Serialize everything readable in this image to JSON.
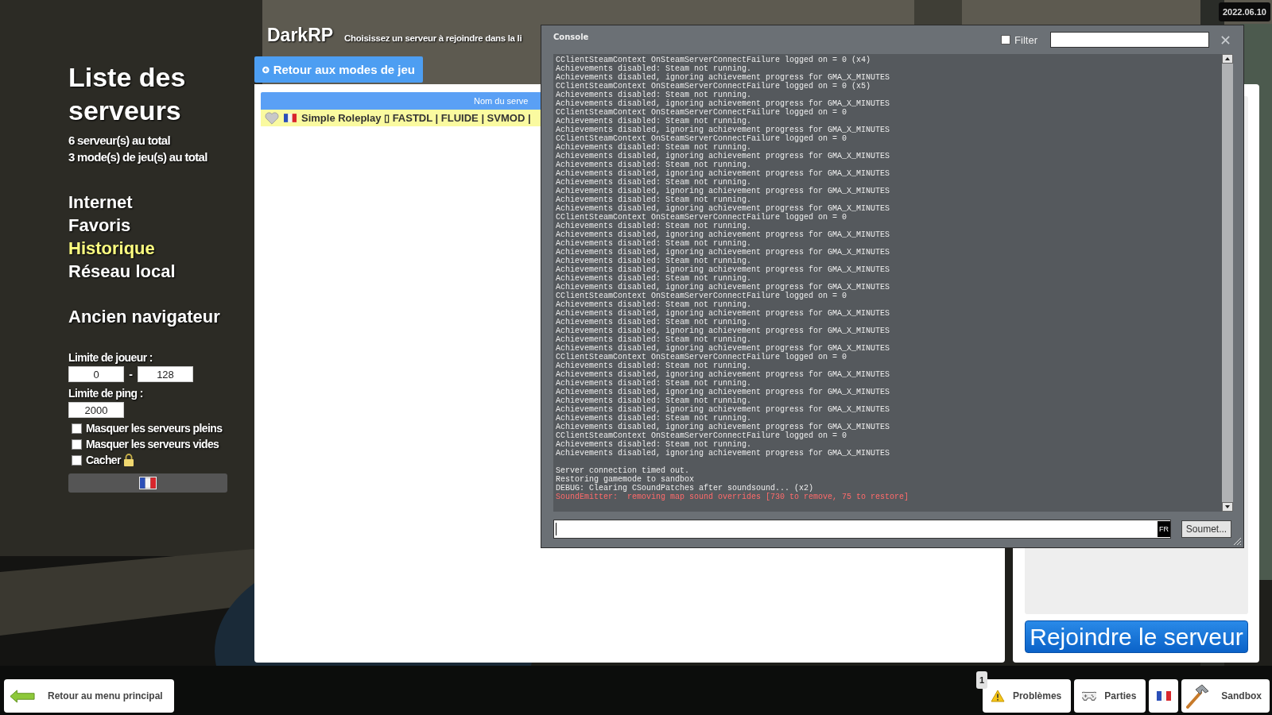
{
  "date": "2022.06.10",
  "sidebar": {
    "title": "Liste des serveurs",
    "stats": [
      "6 serveur(s) au total",
      "3 mode(s) de jeu(s) au total"
    ],
    "nav": [
      {
        "label": "Internet",
        "selected": false
      },
      {
        "label": "Favoris",
        "selected": false
      },
      {
        "label": "Historique",
        "selected": true
      },
      {
        "label": "Réseau local",
        "selected": false
      }
    ],
    "legacy_link": "Ancien navigateur",
    "player_limit": {
      "label": "Limite de joueur :",
      "min": "0",
      "separator": "-",
      "max": "128"
    },
    "ping_limit": {
      "label": "Limite de ping :",
      "value": "2000"
    },
    "options": [
      {
        "label": "Masquer les serveurs pleins",
        "checked": false,
        "locked": false
      },
      {
        "label": "Masquer les serveurs vides",
        "checked": false,
        "locked": false
      },
      {
        "label": "Cacher",
        "checked": false,
        "locked": true
      }
    ]
  },
  "header": {
    "gamemode": "DarkRP",
    "subtitle": "Choisissez un serveur à rejoindre dans la li"
  },
  "back_button": "Retour aux modes de jeu",
  "server_list": {
    "column_header": "Nom du serve",
    "rows": [
      {
        "name": "Simple Roleplay ▯ FASTDL | FLUIDE | SVMOD |",
        "selected": true
      }
    ]
  },
  "join_button": "Rejoindre le serveur",
  "console": {
    "title": "Console",
    "filter": {
      "label": "Filter",
      "checked": false
    },
    "lines": [
      {
        "kind": "log",
        "text": "CClientSteamContext OnSteamServerConnectFailure logged on = 0 (x4)"
      },
      {
        "kind": "log",
        "text": "Achievements disabled: Steam not running."
      },
      {
        "kind": "log",
        "text": "Achievements disabled, ignoring achievement progress for GMA_X_MINUTES"
      },
      {
        "kind": "log",
        "text": "CClientSteamContext OnSteamServerConnectFailure logged on = 0 (x5)"
      },
      {
        "kind": "log",
        "text": "Achievements disabled: Steam not running."
      },
      {
        "kind": "log",
        "text": "Achievements disabled, ignoring achievement progress for GMA_X_MINUTES"
      },
      {
        "kind": "log",
        "text": "CClientSteamContext OnSteamServerConnectFailure logged on = 0"
      },
      {
        "kind": "log",
        "text": "Achievements disabled: Steam not running."
      },
      {
        "kind": "log",
        "text": "Achievements disabled, ignoring achievement progress for GMA_X_MINUTES"
      },
      {
        "kind": "log",
        "text": "CClientSteamContext OnSteamServerConnectFailure logged on = 0"
      },
      {
        "kind": "log",
        "text": "Achievements disabled: Steam not running."
      },
      {
        "kind": "log",
        "text": "Achievements disabled, ignoring achievement progress for GMA_X_MINUTES"
      },
      {
        "kind": "log",
        "text": "Achievements disabled: Steam not running."
      },
      {
        "kind": "log",
        "text": "Achievements disabled, ignoring achievement progress for GMA_X_MINUTES"
      },
      {
        "kind": "log",
        "text": "Achievements disabled: Steam not running."
      },
      {
        "kind": "log",
        "text": "Achievements disabled, ignoring achievement progress for GMA_X_MINUTES"
      },
      {
        "kind": "log",
        "text": "Achievements disabled: Steam not running."
      },
      {
        "kind": "log",
        "text": "Achievements disabled, ignoring achievement progress for GMA_X_MINUTES"
      },
      {
        "kind": "log",
        "text": "CClientSteamContext OnSteamServerConnectFailure logged on = 0"
      },
      {
        "kind": "log",
        "text": "Achievements disabled: Steam not running."
      },
      {
        "kind": "log",
        "text": "Achievements disabled, ignoring achievement progress for GMA_X_MINUTES"
      },
      {
        "kind": "log",
        "text": "Achievements disabled: Steam not running."
      },
      {
        "kind": "log",
        "text": "Achievements disabled, ignoring achievement progress for GMA_X_MINUTES"
      },
      {
        "kind": "log",
        "text": "Achievements disabled: Steam not running."
      },
      {
        "kind": "log",
        "text": "Achievements disabled, ignoring achievement progress for GMA_X_MINUTES"
      },
      {
        "kind": "log",
        "text": "Achievements disabled: Steam not running."
      },
      {
        "kind": "log",
        "text": "Achievements disabled, ignoring achievement progress for GMA_X_MINUTES"
      },
      {
        "kind": "log",
        "text": "CClientSteamContext OnSteamServerConnectFailure logged on = 0"
      },
      {
        "kind": "log",
        "text": "Achievements disabled: Steam not running."
      },
      {
        "kind": "log",
        "text": "Achievements disabled, ignoring achievement progress for GMA_X_MINUTES"
      },
      {
        "kind": "log",
        "text": "Achievements disabled: Steam not running."
      },
      {
        "kind": "log",
        "text": "Achievements disabled, ignoring achievement progress for GMA_X_MINUTES"
      },
      {
        "kind": "log",
        "text": "Achievements disabled: Steam not running."
      },
      {
        "kind": "log",
        "text": "Achievements disabled, ignoring achievement progress for GMA_X_MINUTES"
      },
      {
        "kind": "log",
        "text": "CClientSteamContext OnSteamServerConnectFailure logged on = 0"
      },
      {
        "kind": "log",
        "text": "Achievements disabled: Steam not running."
      },
      {
        "kind": "log",
        "text": "Achievements disabled, ignoring achievement progress for GMA_X_MINUTES"
      },
      {
        "kind": "log",
        "text": "Achievements disabled: Steam not running."
      },
      {
        "kind": "log",
        "text": "Achievements disabled, ignoring achievement progress for GMA_X_MINUTES"
      },
      {
        "kind": "log",
        "text": "Achievements disabled: Steam not running."
      },
      {
        "kind": "log",
        "text": "Achievements disabled, ignoring achievement progress for GMA_X_MINUTES"
      },
      {
        "kind": "log",
        "text": "Achievements disabled: Steam not running."
      },
      {
        "kind": "log",
        "text": "Achievements disabled, ignoring achievement progress for GMA_X_MINUTES"
      },
      {
        "kind": "log",
        "text": "CClientSteamContext OnSteamServerConnectFailure logged on = 0"
      },
      {
        "kind": "log",
        "text": "Achievements disabled: Steam not running."
      },
      {
        "kind": "log",
        "text": "Achievements disabled, ignoring achievement progress for GMA_X_MINUTES"
      },
      {
        "kind": "log",
        "text": "Server connection timed out.",
        "gap_before": true
      },
      {
        "kind": "log",
        "text": "Restoring gamemode to sandbox"
      },
      {
        "kind": "log",
        "text": "DEBUG: Clearing CSoundPatches after soundsound... (x2)"
      },
      {
        "kind": "error",
        "text": "SoundEmitter:  removing map sound overrides [730 to remove, 75 to restore]"
      }
    ],
    "input_badge": "FR",
    "submit": "Soumet..."
  },
  "bottom_bar": {
    "back": "Retour au menu principal",
    "buttons": [
      {
        "kind": "problems",
        "label": "Problèmes",
        "badge": "1"
      },
      {
        "kind": "games",
        "label": "Parties"
      },
      {
        "kind": "language"
      },
      {
        "kind": "sandbox",
        "label": "Sandbox"
      }
    ]
  }
}
